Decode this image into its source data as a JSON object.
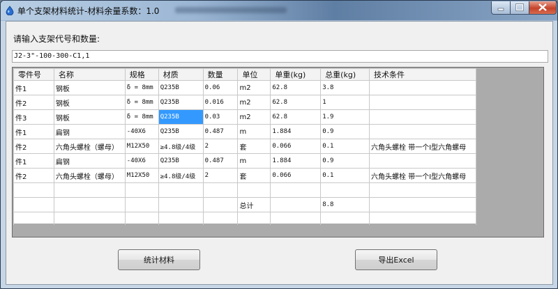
{
  "window": {
    "title": "单个支架材料统计-材料余量系数：1.0"
  },
  "form": {
    "prompt": "请输入支架代号和数量:",
    "code_value": "J2-3\"-100-300-C1,1"
  },
  "table": {
    "columns": [
      "零件号",
      "名称",
      "规格",
      "材质",
      "数量",
      "单位",
      "单重(kg)",
      "总重(kg)",
      "技术条件"
    ],
    "rows": [
      [
        "件1",
        "钢板",
        "δ = 8mm",
        "Q235B",
        "0.06",
        "m2",
        "62.8",
        "3.8",
        ""
      ],
      [
        "件2",
        "钢板",
        "δ = 8mm",
        "Q235B",
        "0.016",
        "m2",
        "62.8",
        "1",
        ""
      ],
      [
        "件3",
        "钢板",
        "δ = 8mm",
        "Q235B",
        "0.03",
        "m2",
        "62.8",
        "1.9",
        ""
      ],
      [
        "件1",
        "扁钢",
        "-40X6",
        "Q235B",
        "0.487",
        "m",
        "1.884",
        "0.9",
        ""
      ],
      [
        "件2",
        "六角头螺栓（螺母）",
        "M12X50",
        "≥4.8级/4级",
        "2",
        "套",
        "0.066",
        "0.1",
        "六角头螺栓 带一个I型六角螺母"
      ],
      [
        "件1",
        "扁钢",
        "-40X6",
        "Q235B",
        "0.487",
        "m",
        "1.884",
        "0.9",
        ""
      ],
      [
        "件2",
        "六角头螺栓（螺母）",
        "M12X50",
        "≥4.8级/4级",
        "2",
        "套",
        "0.066",
        "0.1",
        "六角头螺栓 带一个I型六角螺母"
      ],
      [
        "",
        "",
        "",
        "",
        "",
        "",
        "",
        "",
        ""
      ],
      [
        "",
        "",
        "",
        "",
        "",
        "总计",
        "",
        "8.8",
        ""
      ],
      [
        "",
        "",
        "",
        "",
        "",
        "",
        "",
        "",
        ""
      ]
    ],
    "selected_cell": {
      "row": 2,
      "col": 3
    }
  },
  "buttons": {
    "stats": "统计材料",
    "export": "导出Excel"
  },
  "colors": {
    "selection": "#3399ff",
    "close": "#c5432a"
  },
  "icons": {
    "app": "water-drop-icon",
    "minimize": "minimize-icon",
    "maximize": "maximize-icon",
    "close": "close-icon"
  }
}
